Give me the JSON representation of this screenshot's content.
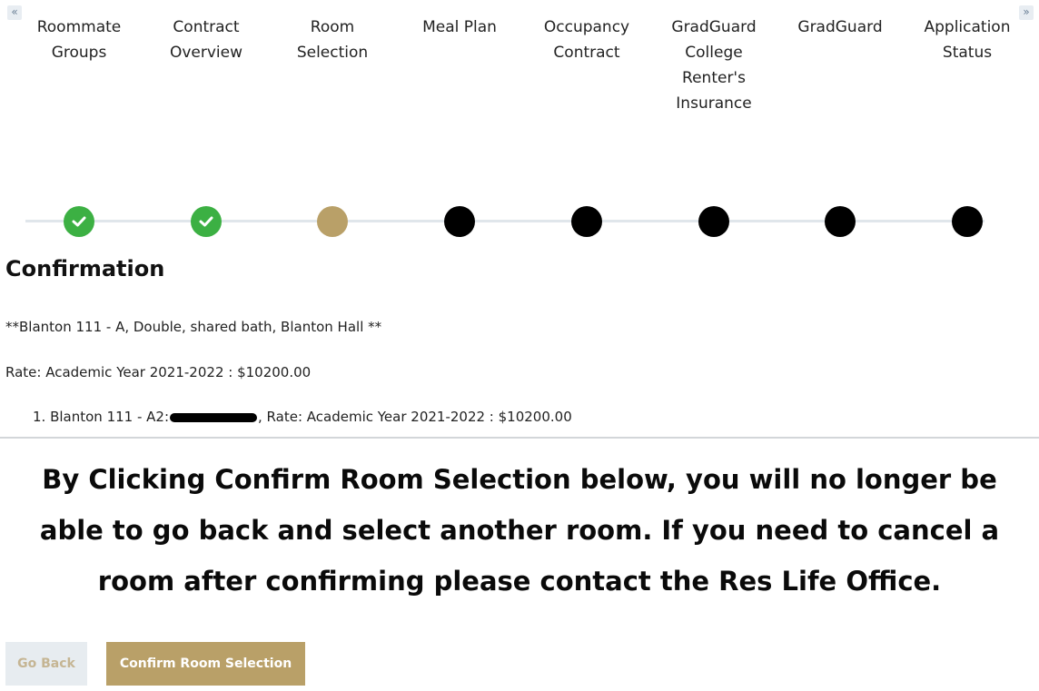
{
  "nav": {
    "prev_arrow": "«",
    "next_arrow": "»",
    "prev_icon": "double-chevron-left-icon",
    "next_icon": "double-chevron-right-icon"
  },
  "steps": [
    {
      "label": "Roommate\nGroups",
      "status": "done"
    },
    {
      "label": "Contract\nOverview",
      "status": "done"
    },
    {
      "label": "Room\nSelection",
      "status": "current"
    },
    {
      "label": "Meal Plan",
      "status": "todo"
    },
    {
      "label": "Occupancy\nContract",
      "status": "todo"
    },
    {
      "label": "GradGuard\nCollege\nRenter's\nInsurance",
      "status": "todo"
    },
    {
      "label": "GradGuard",
      "status": "todo"
    },
    {
      "label": "Application\nStatus",
      "status": "todo"
    }
  ],
  "colors": {
    "done": "#3cb043",
    "current": "#b9a068",
    "todo": "#000000",
    "accent": "#b9a068"
  },
  "confirmation": {
    "heading": "Confirmation",
    "room_line": "**Blanton 111 - A, Double, shared bath, Blanton Hall **",
    "rate_line": "Rate: Academic Year 2021-2022 : $10200.00",
    "occupant_prefix": "1. Blanton 111 - A2:",
    "occupant_suffix": ", Rate: Academic Year 2021-2022 : $10200.00"
  },
  "warning": "By Clicking Confirm Room Selection below, you will no longer be able to go back and select another room. If you need to cancel a room after confirming please contact the Res Life Office.",
  "buttons": {
    "back": "Go Back",
    "confirm": "Confirm Room Selection"
  }
}
